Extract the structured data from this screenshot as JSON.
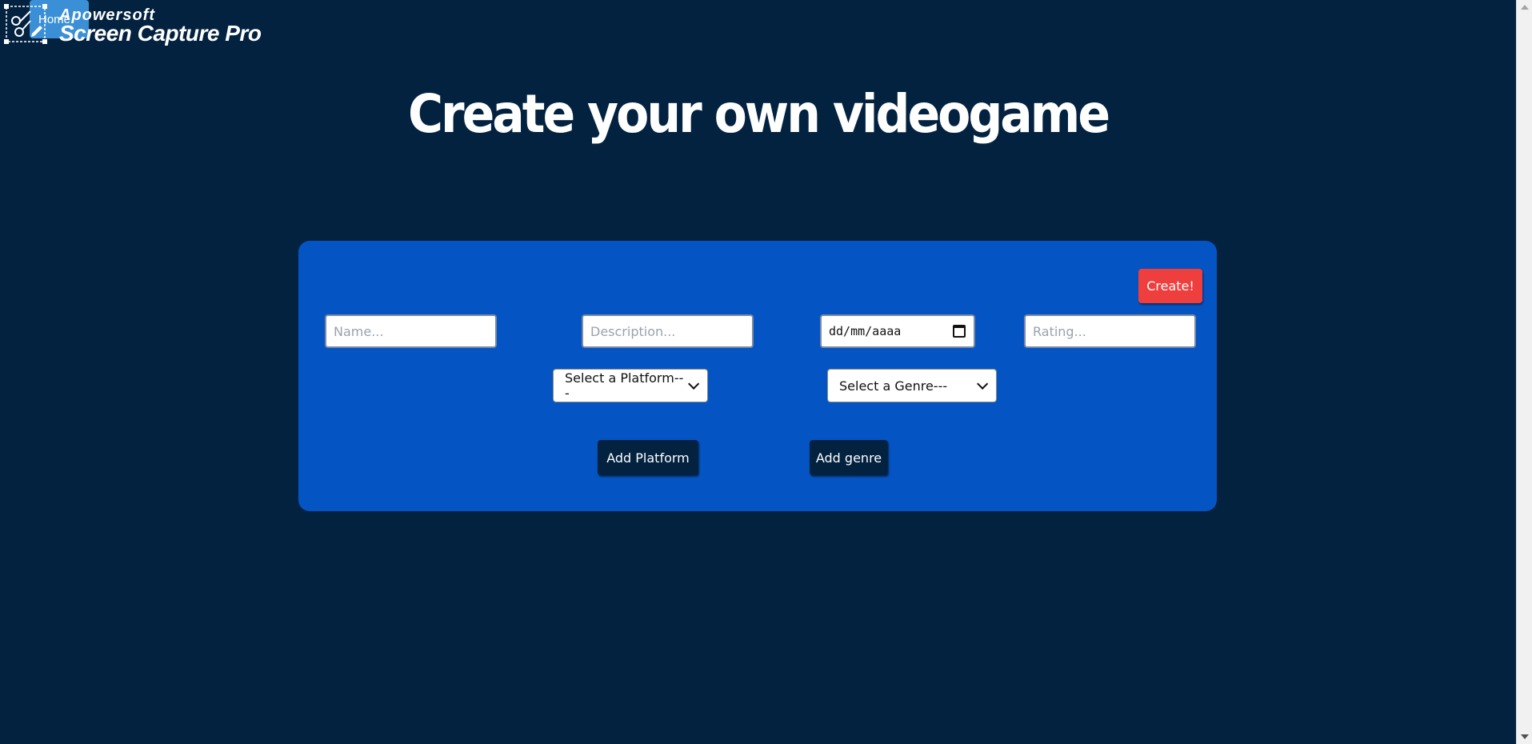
{
  "nav": {
    "home_label": "Home"
  },
  "watermark": {
    "line1": "Apowersoft",
    "line2": "Screen Capture Pro"
  },
  "page_title": "Create your own videogame",
  "form": {
    "create_label": "Create!",
    "name_placeholder": "Name...",
    "description_placeholder": "Description...",
    "date_placeholder": "dd/mm/aaaa",
    "rating_placeholder": "Rating...",
    "platform_select": "Select a Platform---",
    "genre_select": "Select a Genre---",
    "add_platform_label": "Add Platform",
    "add_genre_label": "Add genre"
  },
  "colors": {
    "background": "#022240",
    "panel": "#0455c3",
    "create_button": "#ee3e3e",
    "home_button": "#3a8fd6"
  }
}
